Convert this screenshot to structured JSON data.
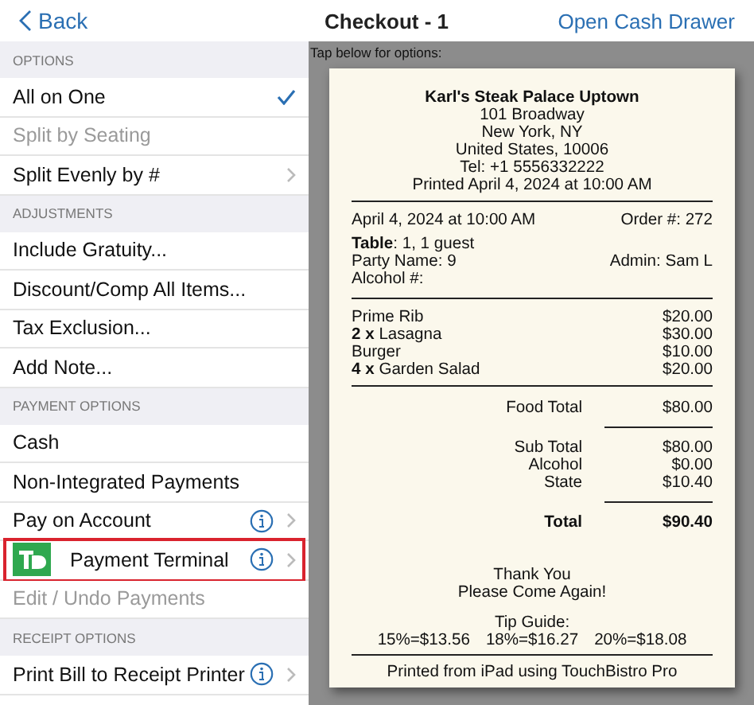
{
  "nav": {
    "back": "Back",
    "title": "Checkout - 1",
    "action": "Open Cash Drawer"
  },
  "sections": [
    {
      "title": "OPTIONS",
      "items": [
        {
          "label": "All on One",
          "selected": true,
          "disabled": false,
          "chevron": false,
          "info": false,
          "logo": false,
          "highlighted": false
        },
        {
          "label": "Split by Seating",
          "selected": false,
          "disabled": true,
          "chevron": false,
          "info": false,
          "logo": false,
          "highlighted": false
        },
        {
          "label": "Split Evenly by #",
          "selected": false,
          "disabled": false,
          "chevron": true,
          "info": false,
          "logo": false,
          "highlighted": false
        }
      ]
    },
    {
      "title": "ADJUSTMENTS",
      "items": [
        {
          "label": "Include Gratuity...",
          "selected": false,
          "disabled": false,
          "chevron": false,
          "info": false,
          "logo": false,
          "highlighted": false
        },
        {
          "label": "Discount/Comp All Items...",
          "selected": false,
          "disabled": false,
          "chevron": false,
          "info": false,
          "logo": false,
          "highlighted": false
        },
        {
          "label": "Tax Exclusion...",
          "selected": false,
          "disabled": false,
          "chevron": false,
          "info": false,
          "logo": false,
          "highlighted": false
        },
        {
          "label": "Add Note...",
          "selected": false,
          "disabled": false,
          "chevron": false,
          "info": false,
          "logo": false,
          "highlighted": false
        }
      ]
    },
    {
      "title": "PAYMENT OPTIONS",
      "items": [
        {
          "label": "Cash",
          "selected": false,
          "disabled": false,
          "chevron": false,
          "info": false,
          "logo": false,
          "highlighted": false
        },
        {
          "label": "Non-Integrated Payments",
          "selected": false,
          "disabled": false,
          "chevron": false,
          "info": false,
          "logo": false,
          "highlighted": false
        },
        {
          "label": "Pay on Account",
          "selected": false,
          "disabled": false,
          "chevron": true,
          "info": true,
          "logo": false,
          "highlighted": false
        },
        {
          "label": "Payment Terminal",
          "selected": false,
          "disabled": false,
          "chevron": true,
          "info": true,
          "logo": true,
          "highlighted": true
        },
        {
          "label": "Edit / Undo Payments",
          "selected": false,
          "disabled": true,
          "chevron": false,
          "info": false,
          "logo": false,
          "highlighted": false
        }
      ]
    },
    {
      "title": "RECEIPT OPTIONS",
      "items": [
        {
          "label": "Print Bill to Receipt Printer",
          "selected": false,
          "disabled": false,
          "chevron": true,
          "info": true,
          "logo": false,
          "highlighted": false
        }
      ]
    }
  ],
  "receipt_hint": "Tap below for options:",
  "receipt": {
    "restaurant": "Karl's Steak Palace Uptown",
    "address_lines": [
      "101 Broadway",
      "New York, NY",
      "United States, 10006",
      "Tel: +1 5556332222",
      "Printed April 4, 2024 at 10:00 AM"
    ],
    "date": "April 4, 2024 at 10:00 AM",
    "order_number": "Order #: 272",
    "table": "**Table**: 1, 1 guest",
    "party_name": "Party Name: 9",
    "admin": "Admin: Sam L",
    "alcohol": "Alcohol #:",
    "items": [
      {
        "name": "Prime Rib",
        "price": "$20.00"
      },
      {
        "name": "**2 x** Lasagna",
        "price": "$30.00"
      },
      {
        "name": "Burger",
        "price": "$10.00"
      },
      {
        "name": "**4 x** Garden Salad",
        "price": "$20.00"
      }
    ],
    "food_total": {
      "label": "Food Total",
      "value": "$80.00"
    },
    "subtotals": [
      {
        "label": "Sub Total",
        "value": "$80.00"
      },
      {
        "label": "Alcohol",
        "value": "$0.00"
      },
      {
        "label": "State",
        "value": "$10.40"
      }
    ],
    "total": {
      "label": "Total",
      "value": "$90.40"
    },
    "thanks": [
      "Thank You",
      "Please Come Again!"
    ],
    "tip_title": "Tip Guide:",
    "tips": [
      "15%=$13.56",
      "18%=$16.27",
      "20%=$18.08"
    ],
    "footer": "Printed from iPad using TouchBistro Pro"
  }
}
